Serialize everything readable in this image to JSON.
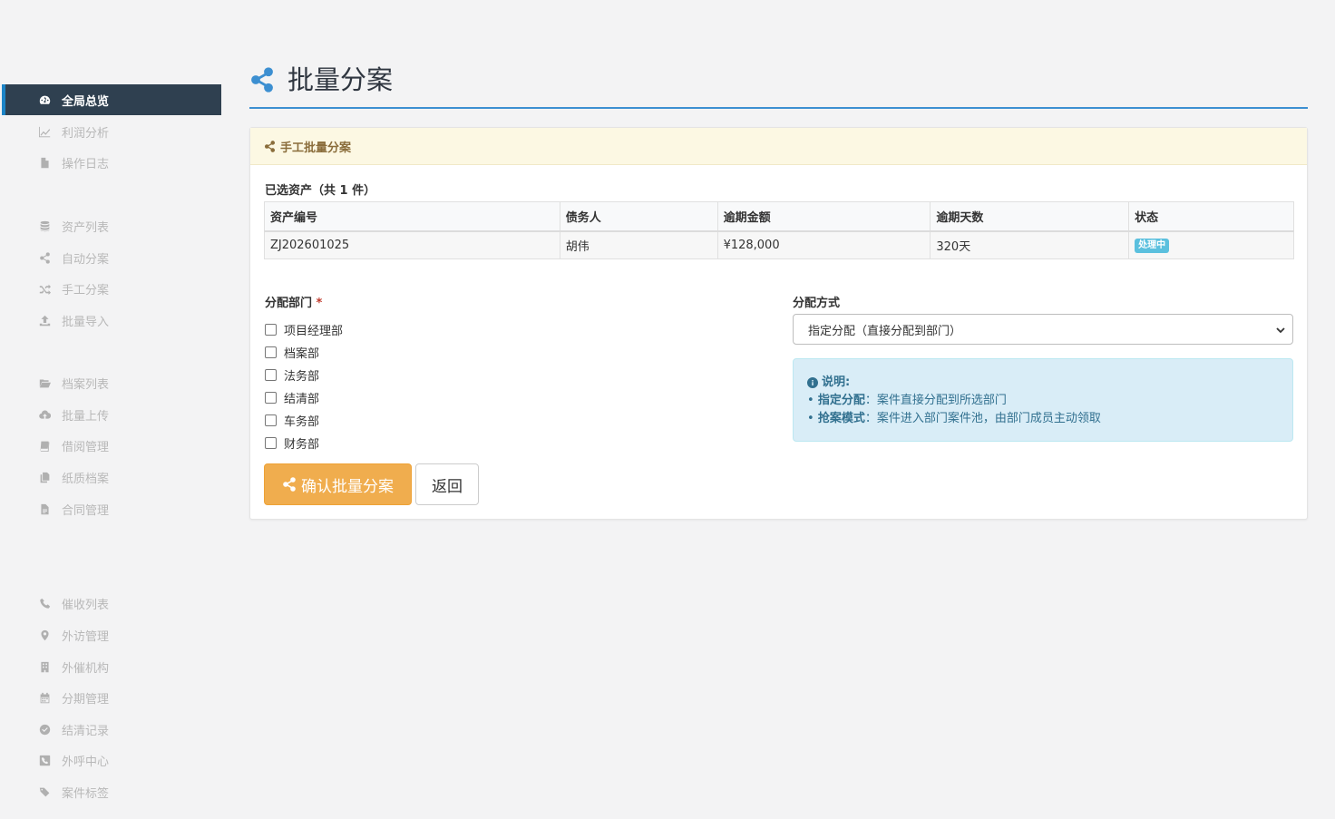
{
  "sidebar": {
    "items": [
      {
        "label": "全局总览",
        "icon": "dashboard-icon",
        "active": true
      },
      {
        "label": "利润分析",
        "icon": "line-chart-icon"
      },
      {
        "label": "操作日志",
        "icon": "file-icon"
      },
      {
        "label": "资产列表",
        "icon": "database-icon"
      },
      {
        "label": "自动分案",
        "icon": "share-icon"
      },
      {
        "label": "手工分案",
        "icon": "shuffle-icon"
      },
      {
        "label": "批量导入",
        "icon": "upload-icon"
      },
      {
        "label": "档案列表",
        "icon": "folder-open-icon"
      },
      {
        "label": "批量上传",
        "icon": "cloud-upload-icon"
      },
      {
        "label": "借阅管理",
        "icon": "book-icon"
      },
      {
        "label": "纸质档案",
        "icon": "copy-icon"
      },
      {
        "label": "合同管理",
        "icon": "file-text-icon"
      },
      {
        "label": "催收列表",
        "icon": "phone-icon"
      },
      {
        "label": "外访管理",
        "icon": "map-marker-icon"
      },
      {
        "label": "外催机构",
        "icon": "building-icon"
      },
      {
        "label": "分期管理",
        "icon": "calendar-icon"
      },
      {
        "label": "结清记录",
        "icon": "check-circle-icon"
      },
      {
        "label": "外呼中心",
        "icon": "phone-square-icon"
      },
      {
        "label": "案件标签",
        "icon": "tags-icon"
      }
    ]
  },
  "header": {
    "title": "批量分案",
    "icon": "share-icon"
  },
  "panel": {
    "heading": "手工批量分案",
    "selected_prefix": "已选资产（共 ",
    "selected_count": "1",
    "selected_suffix": " 件）",
    "table": {
      "columns": [
        "资产编号",
        "债务人",
        "逾期金额",
        "逾期天数",
        "状态"
      ],
      "rows": [
        {
          "id": "ZJ202601025",
          "debtor": "胡伟",
          "amount": "¥128,000",
          "days": "320天",
          "status": "处理中"
        }
      ]
    },
    "dept_label": "分配部门",
    "required_mark": "*",
    "departments": [
      "项目经理部",
      "档案部",
      "法务部",
      "结清部",
      "车务部",
      "财务部"
    ],
    "method_label": "分配方式",
    "method_selected": "指定分配（直接分配到部门）",
    "info": {
      "title": "说明:",
      "line1_key": "指定分配",
      "line1_text": "：案件直接分配到所选部门",
      "line2_key": "抢案模式",
      "line2_text": "：案件进入部门案件池，由部门成员主动领取"
    },
    "confirm_button": "确认批量分案",
    "back_button": "返回"
  },
  "colors": {
    "accent": "#3c8fd1",
    "sidebar_active": "#2f4050",
    "warning": "#f0ad4e",
    "info_bg": "#d9edf7",
    "money": "#c0392b"
  }
}
